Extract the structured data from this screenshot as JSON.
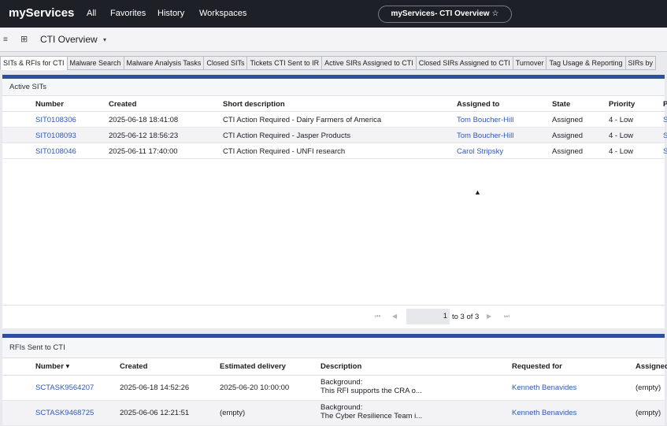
{
  "app": {
    "logo": "myServices",
    "nav": [
      "All",
      "Favorites",
      "History",
      "Workspaces"
    ],
    "pill": "myServices- CTI Overview",
    "pill_icon": "star-icon"
  },
  "subbar": {
    "title": "CTI Overview"
  },
  "tabs": [
    "SITs & RFIs for CTI",
    "Malware Search",
    "Malware Analysis Tasks",
    "Closed SITs",
    "Tickets CTI Sent to IR",
    "Active SIRs Assigned to CTI",
    "Closed SIRs Assigned to CTI",
    "Turnover",
    "Tag Usage & Reporting",
    "SIRs by"
  ],
  "active_sits": {
    "title": "Active SITs",
    "columns": [
      "Number",
      "Created",
      "Short description",
      "Assigned to",
      "State",
      "Priority",
      "P"
    ],
    "rows": [
      {
        "number": "SIT0108306",
        "created": "2025-06-18 18:41:08",
        "desc": "CTI Action Required - Dairy Farmers of America",
        "assigned": "Tom Boucher-Hill",
        "state": "Assigned",
        "priority": "4 - Low",
        "p": "S"
      },
      {
        "number": "SIT0108093",
        "created": "2025-06-12 18:56:23",
        "desc": "CTI Action Required - Jasper Products",
        "assigned": "Tom Boucher-Hill",
        "state": "Assigned",
        "priority": "4 - Low",
        "p": "S"
      },
      {
        "number": "SIT0108046",
        "created": "2025-06-11 17:40:00",
        "desc": "CTI Action Required - UNFI research",
        "assigned": "Carol Stripsky",
        "state": "Assigned",
        "priority": "4 - Low",
        "p": "S"
      }
    ],
    "pager": {
      "page": "1",
      "range": "to 3 of 3"
    }
  },
  "rfis": {
    "title": "RFIs Sent to CTI",
    "columns": [
      "Number",
      "Created",
      "Estimated delivery",
      "Description",
      "Requested for",
      "Assigned t"
    ],
    "rows": [
      {
        "number": "SCTASK9564207",
        "created": "2025-06-18 14:52:26",
        "delivery": "2025-06-20 10:00:00",
        "desc1": "Background:",
        "desc2": "This RFI supports the CRA o...",
        "requested": "Kenneth Benavides",
        "assigned": "(empty)"
      },
      {
        "number": "SCTASK9468725",
        "created": "2025-06-06 12:21:51",
        "delivery": "(empty)",
        "desc1": "Background:",
        "desc2": "The Cyber Resilience Team i...",
        "requested": "Kenneth Benavides",
        "assigned": "(empty)"
      }
    ]
  }
}
